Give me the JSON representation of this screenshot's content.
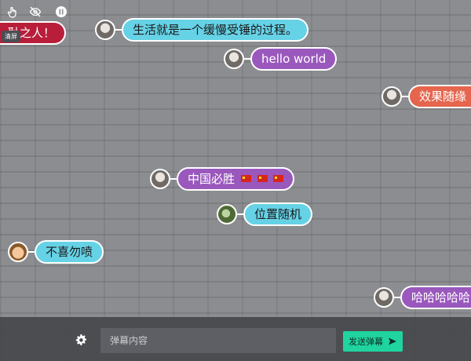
{
  "toolbar": {
    "icons": [
      "hand-pointer-icon",
      "eye-off-icon",
      "pause-icon"
    ],
    "clear_tip": "清屏"
  },
  "danmaku": [
    {
      "text": "耻之人！",
      "color": "#b81e3a",
      "avatar": "none"
    },
    {
      "text": "生活就是一个缓慢受锤的过程。",
      "color": "#66d2e6",
      "avatar": "gray-portrait"
    },
    {
      "text": "hello world",
      "color": "#9a58bd",
      "avatar": "gray-portrait"
    },
    {
      "text": "效果随缘",
      "color": "#e5654d",
      "avatar": "gray-portrait"
    },
    {
      "text": "中国必胜",
      "color": "#9a58bd",
      "avatar": "gray-portrait",
      "emoji": [
        "cn-flag",
        "cn-flag",
        "cn-flag"
      ]
    },
    {
      "text": "位置随机",
      "color": "#66d2e6",
      "avatar": "green-frog"
    },
    {
      "text": "不喜勿喷",
      "color": "#66d2e6",
      "avatar": "cartoon-face"
    },
    {
      "text": "哈哈哈哈哈",
      "color": "#9a58bd",
      "avatar": "gray-portrait"
    }
  ],
  "bottom_bar": {
    "input_placeholder": "弹幕内容",
    "input_value": "",
    "send_label": "发送弹幕",
    "send_color": "#20d4a0"
  }
}
